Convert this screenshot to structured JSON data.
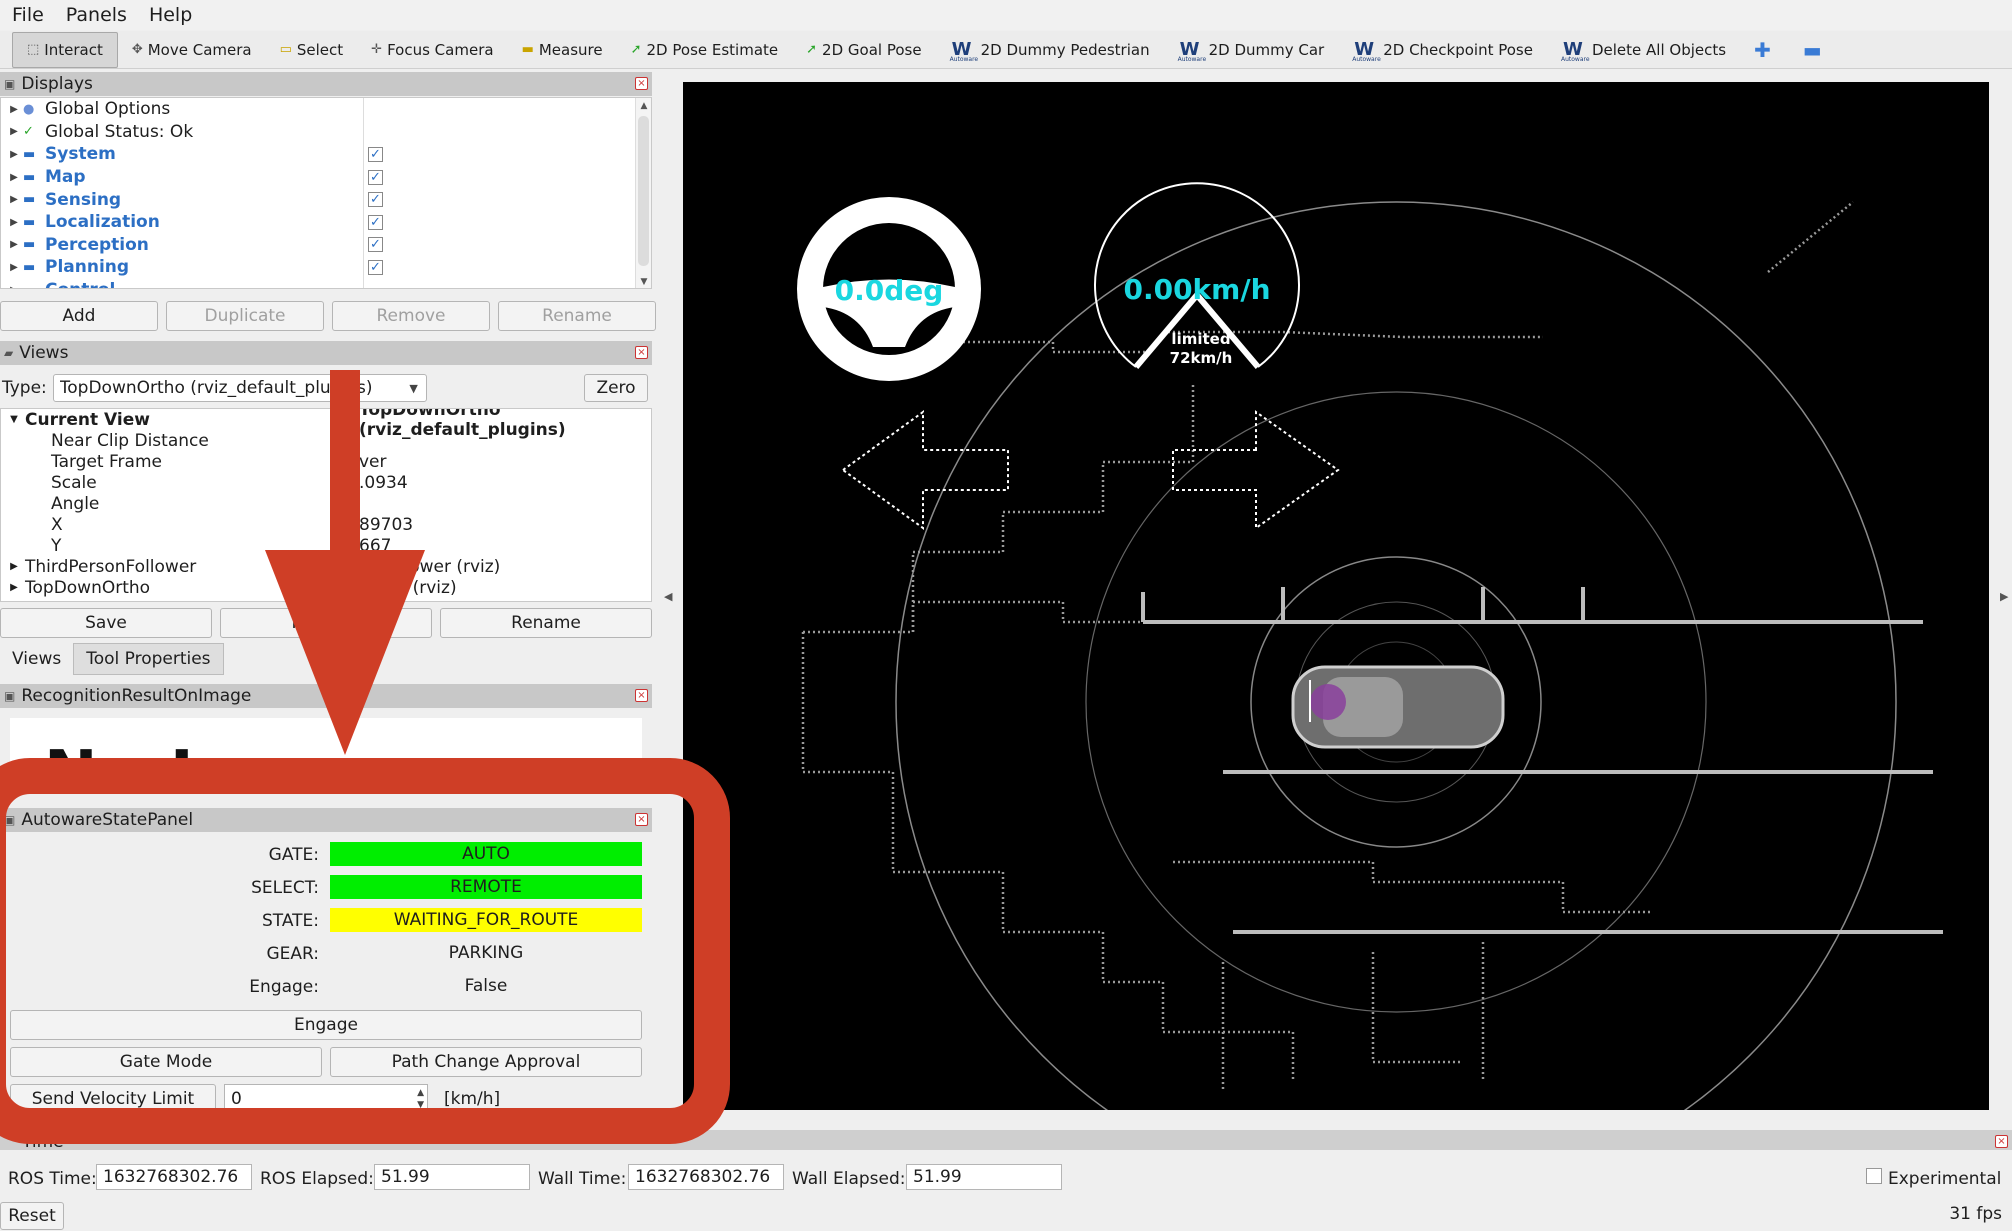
{
  "menu": [
    "File",
    "Panels",
    "Help"
  ],
  "toolbar": {
    "interact": "Interact",
    "move_camera": "Move Camera",
    "select": "Select",
    "focus_camera": "Focus Camera",
    "measure": "Measure",
    "pose_estimate": "2D Pose Estimate",
    "goal_pose": "2D Goal Pose",
    "dummy_pedestrian": "2D Dummy Pedestrian",
    "dummy_car": "2D Dummy Car",
    "checkpoint_pose": "2D Checkpoint Pose",
    "delete_all": "Delete All Objects"
  },
  "displays": {
    "title": "Displays",
    "items": [
      {
        "label": "Global Options",
        "blue": false
      },
      {
        "label": "Global Status: Ok",
        "blue": false
      },
      {
        "label": "System",
        "blue": true
      },
      {
        "label": "Map",
        "blue": true
      },
      {
        "label": "Sensing",
        "blue": true
      },
      {
        "label": "Localization",
        "blue": true
      },
      {
        "label": "Perception",
        "blue": true
      },
      {
        "label": "Planning",
        "blue": true
      },
      {
        "label": "Control",
        "blue": true
      }
    ],
    "buttons": {
      "add": "Add",
      "duplicate": "Duplicate",
      "remove": "Remove",
      "rename": "Rename"
    }
  },
  "views": {
    "title": "Views",
    "type_label": "Type:",
    "type_value": "TopDownOrtho (rviz_default_plugins)",
    "zero": "Zero",
    "current_view": "Current View",
    "current_view_value": "TopDownOrtho (rviz_default_plugins)",
    "props": [
      {
        "name": "Near Clip Distance",
        "value": ""
      },
      {
        "name": "Target Frame",
        "value": "ver"
      },
      {
        "name": "Scale",
        "value": ".0934"
      },
      {
        "name": "Angle",
        "value": ""
      },
      {
        "name": "X",
        "value": "89703"
      },
      {
        "name": "Y",
        "value": "667"
      }
    ],
    "saved": [
      {
        "name": "ThirdPersonFollower",
        "value": "onFollower (rviz)"
      },
      {
        "name": "TopDownOrtho",
        "value": "Ortho (rviz)"
      }
    ],
    "buttons": {
      "save": "Save",
      "remove": "Remove",
      "rename": "Rename"
    },
    "tabs": [
      "Views",
      "Tool Properties"
    ]
  },
  "recognition": {
    "title": "RecognitionResultOnImage",
    "no_image": "No Image"
  },
  "autoware": {
    "title": "AutowareStatePanel",
    "gate_label": "GATE:",
    "gate_value": "AUTO",
    "select_label": "SELECT:",
    "select_value": "REMOTE",
    "state_label": "STATE:",
    "state_value": "WAITING_FOR_ROUTE",
    "gear_label": "GEAR:",
    "gear_value": "PARKING",
    "engage_label": "Engage:",
    "engage_value": "False",
    "engage_button": "Engage",
    "gate_mode_button": "Gate Mode",
    "path_change_button": "Path Change Approval",
    "send_velocity_button": "Send Velocity Limit",
    "velocity_value": "0",
    "velocity_unit": "[km/h]",
    "colors": {
      "green": "#00ee00",
      "yellow": "#ffff00"
    }
  },
  "viewport": {
    "steering": "0.0deg",
    "speed": "0.00km/h",
    "limited_label": "limited",
    "limit_value": "72km/h"
  },
  "time": {
    "title": "Time",
    "ros_time_label": "ROS Time:",
    "ros_time_value": "1632768302.76",
    "ros_elapsed_label": "ROS Elapsed:",
    "ros_elapsed_value": "51.99",
    "wall_time_label": "Wall Time:",
    "wall_time_value": "1632768302.76",
    "wall_elapsed_label": "Wall Elapsed:",
    "wall_elapsed_value": "51.99",
    "experimental": "Experimental",
    "fps": "31 fps",
    "reset": "Reset"
  }
}
